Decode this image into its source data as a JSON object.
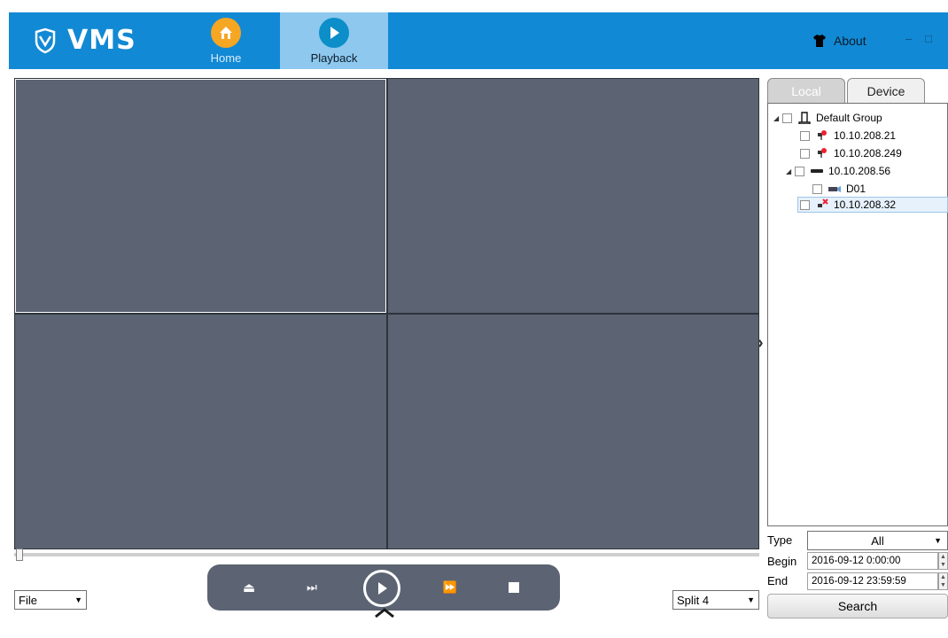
{
  "app": {
    "logo_text": "VMS"
  },
  "nav": {
    "home_label": "Home",
    "playback_label": "Playback",
    "about_label": "About"
  },
  "window_controls": {
    "minimize": "–",
    "maximize": "□"
  },
  "player": {
    "file_select": "File",
    "split_select": "Split 4",
    "progress": 0,
    "buttons": [
      "eject",
      "step-forward",
      "play",
      "fast-forward",
      "stop"
    ]
  },
  "panel": {
    "tabs": [
      {
        "label": "Local",
        "active": true
      },
      {
        "label": "Device",
        "active": false
      }
    ],
    "tree": [
      {
        "label": "Default Group",
        "icon": "group-icon",
        "expanded": true
      },
      {
        "label": "10.10.208.21",
        "icon": "device-online-icon"
      },
      {
        "label": "10.10.208.249",
        "icon": "device-online-icon"
      },
      {
        "label": "10.10.208.56",
        "icon": "nvr-icon",
        "expanded": true
      },
      {
        "label": "D01",
        "icon": "camera-icon"
      },
      {
        "label": "10.10.208.32",
        "icon": "device-offline-icon",
        "selected": true
      }
    ],
    "type_label": "Type",
    "type_value": "All",
    "begin_label": "Begin",
    "begin_value": "2016-09-12 0:00:00",
    "end_label": "End",
    "end_value": "2016-09-12 23:59:59",
    "search_label": "Search"
  },
  "colors": {
    "header": "#1289d4",
    "active_tab": "#8ec8ee",
    "video_bg": "#5c6473",
    "home_icon": "#f5a623"
  }
}
